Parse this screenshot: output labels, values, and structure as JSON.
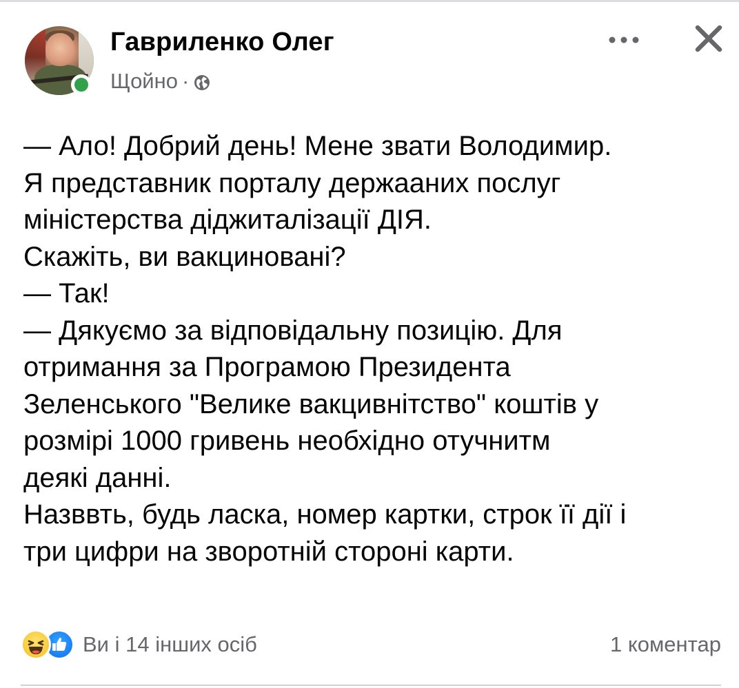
{
  "post": {
    "author": "Гавриленко Олег",
    "time": "Щойно",
    "separator": "·",
    "privacy_icon": "globe-icon",
    "menu_icon": "more-options-icon",
    "close_icon": "close-icon",
    "online_status_color": "#31a24c",
    "lines": [
      "— Ало! Добрий день! Мене звати Володимир.",
      "Я представник порталу держааних послуг",
      "міністерства діджиталізації ДІЯ.",
      "Скажіть, ви вакциновані?",
      "— Так!",
      "— Дякуємо за відповідальну позицію. Для",
      "отримання за Програмою Президента",
      "Зеленського \"Велике вакцивнітство\" коштів у",
      "розмірі 1000 гривень необхідно отучнитм",
      "деякі данні.",
      "Назввть, будь ласка, номер картки, строк її дії і",
      "три цифри на зворотній стороні карти."
    ]
  },
  "footer": {
    "reaction_icons": [
      "haha-icon",
      "like-icon"
    ],
    "reactions_text": "Ви і 14 інших осіб",
    "comments_text": "1 коментар"
  },
  "colors": {
    "text": "#050505",
    "secondary": "#65676b",
    "like_blue": "#1877f2"
  }
}
